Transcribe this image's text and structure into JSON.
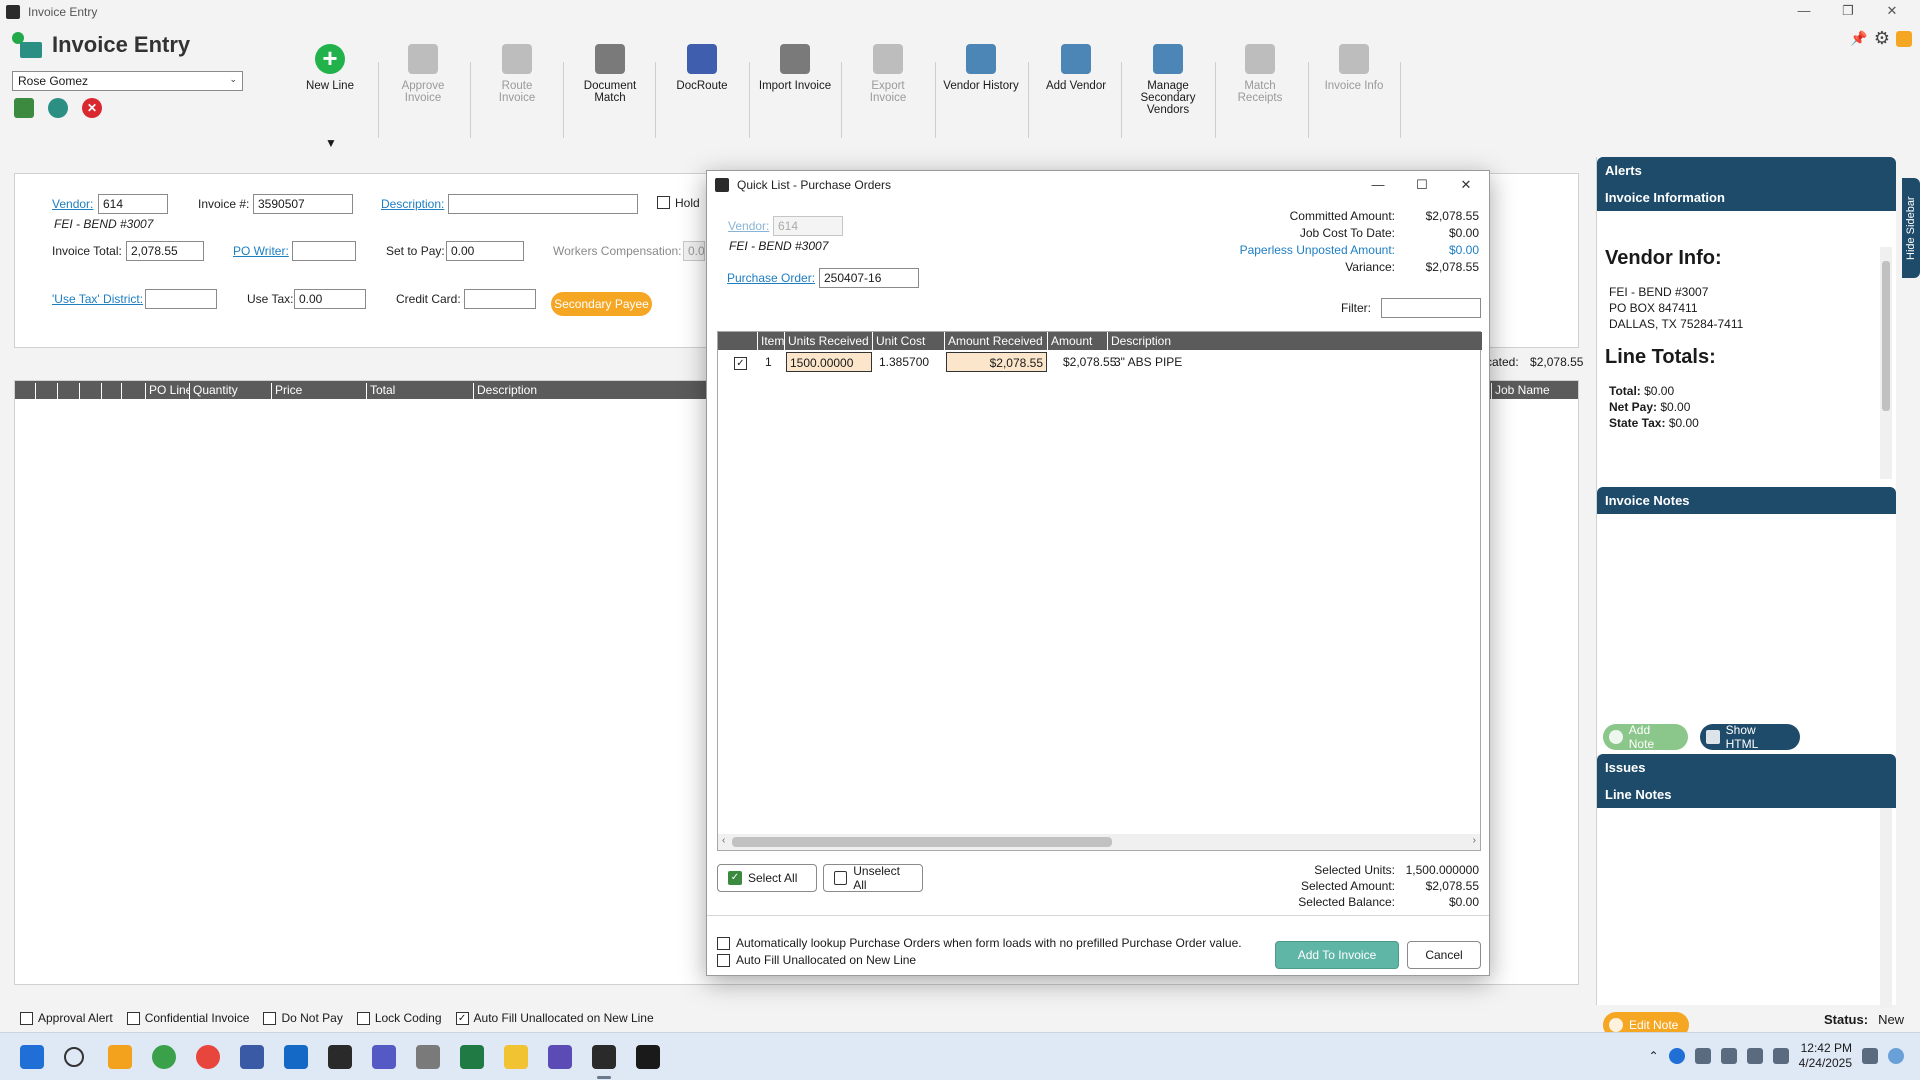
{
  "window": {
    "title": "Invoice Entry"
  },
  "app": {
    "title": "Invoice Entry",
    "user": "Rose Gomez"
  },
  "ribbon": {
    "buttons": [
      {
        "label": "New Line",
        "icon": "plus-circle-icon",
        "enabled": true
      },
      {
        "label": "Approve Invoice",
        "icon": "approve-invoice-icon",
        "enabled": false
      },
      {
        "label": "Route Invoice",
        "icon": "route-invoice-icon",
        "enabled": false
      },
      {
        "label": "Document Match",
        "icon": "document-match-icon",
        "enabled": true
      },
      {
        "label": "DocRoute",
        "icon": "docroute-icon",
        "enabled": true
      },
      {
        "label": "Import Invoice",
        "icon": "import-invoice-icon",
        "enabled": true
      },
      {
        "label": "Export Invoice",
        "icon": "export-invoice-icon",
        "enabled": false
      },
      {
        "label": "Vendor History",
        "icon": "vendor-history-icon",
        "enabled": true
      },
      {
        "label": "Add Vendor",
        "icon": "add-vendor-icon",
        "enabled": true
      },
      {
        "label": "Manage Secondary Vendors",
        "icon": "manage-vendors-icon",
        "enabled": true
      },
      {
        "label": "Match Receipts",
        "icon": "match-receipts-icon",
        "enabled": false
      },
      {
        "label": "Invoice Info",
        "icon": "invoice-info-icon",
        "enabled": false
      }
    ],
    "new_line_arrow": "▼"
  },
  "form": {
    "vendor_label": "Vendor:",
    "vendor_value": "614",
    "vendor_name": "FEI - BEND #3007",
    "invoice_no_label": "Invoice #:",
    "invoice_no_value": "3590507",
    "description_label": "Description:",
    "description_value": "",
    "hold_label": "Hold",
    "invoice_total_label": "Invoice Total:",
    "invoice_total_value": "2,078.55",
    "po_writer_label": "PO Writer:",
    "po_writer_value": "",
    "set_to_pay_label": "Set to Pay:",
    "set_to_pay_value": "0.00",
    "workers_comp_label": "Workers Compensation:",
    "workers_comp_value": "0.0",
    "use_tax_district_label": "'Use Tax' District:",
    "use_tax_district_value": "",
    "use_tax_label": "Use Tax:",
    "use_tax_value": "0.00",
    "credit_card_label": "Credit Card:",
    "credit_card_value": "",
    "secondary_payee_label": "Secondary Payee",
    "allocated_label": "cated:",
    "allocated_value": "$2,078.55"
  },
  "lines_grid": {
    "columns": [
      "PO Line",
      "Quantity",
      "Price",
      "Total",
      "Description",
      "Job Name"
    ]
  },
  "bottom": {
    "checkboxes": [
      {
        "label": "Approval Alert",
        "checked": false
      },
      {
        "label": "Confidential Invoice",
        "checked": false
      },
      {
        "label": "Do Not Pay",
        "checked": false
      },
      {
        "label": "Lock Coding",
        "checked": false
      },
      {
        "label": "Auto Fill Unallocated on New Line",
        "checked": true
      }
    ],
    "status_label": "Status:",
    "status_value": "New"
  },
  "sidebar": {
    "alerts": "Alerts",
    "invoice_information": "Invoice Information",
    "vendor_info_title": "Vendor Info:",
    "vendor_lines": [
      "FEI - BEND #3007",
      "PO BOX 847411",
      "DALLAS, TX 75284-7411"
    ],
    "line_totals_title": "Line Totals:",
    "line_totals": [
      {
        "label": "Total:",
        "value": "$0.00"
      },
      {
        "label": "Net Pay:",
        "value": "$0.00"
      },
      {
        "label": "State Tax:",
        "value": "$0.00"
      }
    ],
    "invoice_notes": "Invoice Notes",
    "add_note": "Add Note",
    "show_html": "Show HTML",
    "issues": "Issues",
    "line_notes": "Line Notes",
    "edit_note": "Edit Note",
    "hide_sidebar": "Hide Sidebar"
  },
  "dialog": {
    "title": "Quick List - Purchase Orders",
    "vendor_label": "Vendor:",
    "vendor_value": "614",
    "vendor_name": "FEI - BEND #3007",
    "po_label": "Purchase Order:",
    "po_value": "250407-16",
    "filter_label": "Filter:",
    "filter_value": "",
    "summary": [
      {
        "label": "Committed Amount:",
        "value": "$2,078.55",
        "style": "normal"
      },
      {
        "label": "Job Cost To Date:",
        "value": "$0.00",
        "style": "normal"
      },
      {
        "label": "Paperless Unposted Amount:",
        "value": "$0.00",
        "style": "blue"
      },
      {
        "label": "Variance:",
        "value": "$2,078.55",
        "style": "normal"
      }
    ],
    "columns": [
      "",
      "Item",
      "Units Received",
      "Unit Cost",
      "Amount Received",
      "Amount",
      "Description"
    ],
    "rows": [
      {
        "checked": true,
        "item": "1",
        "units_received": "1500.00000",
        "unit_cost": "1.385700",
        "amount_received": "$2,078.55",
        "amount": "$2,078.55",
        "description": "3\" ABS PIPE"
      }
    ],
    "select_all": "Select All",
    "unselect_all": "Unselect All",
    "selected": [
      {
        "label": "Selected Units:",
        "value": "1,500.000000"
      },
      {
        "label": "Selected Amount:",
        "value": "$2,078.55"
      },
      {
        "label": "Selected Balance:",
        "value": "$0.00"
      }
    ],
    "auto_lookup_label": "Automatically lookup Purchase Orders when form loads with no prefilled Purchase Order value.",
    "auto_fill_label": "Auto Fill Unallocated on New Line",
    "add_to_invoice": "Add To Invoice",
    "cancel": "Cancel"
  },
  "taskbar": {
    "time": "12:42 PM",
    "date": "4/24/2025"
  }
}
